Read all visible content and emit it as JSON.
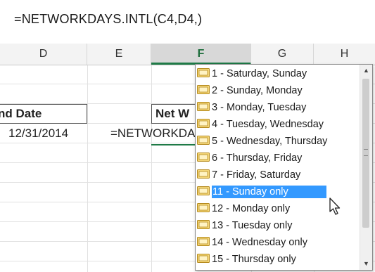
{
  "formula_bar": {
    "text": "=NETWORKDAYS.INTL(C4,D4,)"
  },
  "columns": [
    "D",
    "E",
    "F",
    "G",
    "H"
  ],
  "selected_column": "F",
  "cells": {
    "end_date_label": "nd Date",
    "end_date_value": "12/31/2014",
    "net_label": "Net W",
    "formula_partial": "=NETWORKDA"
  },
  "dropdown": {
    "items": [
      {
        "label": "1 - Saturday, Sunday"
      },
      {
        "label": "2 - Sunday, Monday"
      },
      {
        "label": "3 - Monday, Tuesday"
      },
      {
        "label": "4 - Tuesday, Wednesday"
      },
      {
        "label": "5 - Wednesday, Thursday"
      },
      {
        "label": "6 - Thursday, Friday"
      },
      {
        "label": "7 - Friday, Saturday"
      },
      {
        "label": "11 - Sunday only",
        "selected": true
      },
      {
        "label": "12 - Monday only"
      },
      {
        "label": "13 - Tuesday only"
      },
      {
        "label": "14 - Wednesday only"
      },
      {
        "label": "15 - Thursday only"
      }
    ],
    "scroll_up_icon": "scroll-up-arrow-icon",
    "scroll_down_icon": "scroll-down-arrow-icon"
  },
  "colors": {
    "selection": "#3399ff",
    "accent_green": "#1e7a46",
    "icon_fill": "#f5d87a",
    "icon_border": "#b58a1e"
  }
}
